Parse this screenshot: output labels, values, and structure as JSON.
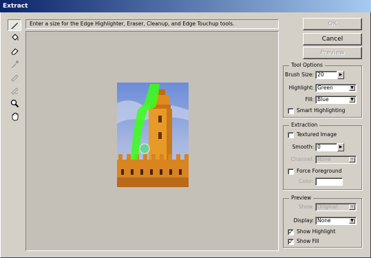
{
  "window": {
    "title": "Extract"
  },
  "hint": "Enter a size for the Edge Highlighter, Eraser, Cleanup, and Edge Touchup tools.",
  "tools": [
    {
      "name": "edge-highlighter-icon",
      "active": true
    },
    {
      "name": "fill-bucket-icon",
      "active": false
    },
    {
      "name": "eraser-icon",
      "active": false
    },
    {
      "name": "eyedropper-icon",
      "active": false
    },
    {
      "name": "cleanup-icon",
      "active": false
    },
    {
      "name": "edge-touchup-icon",
      "active": false
    },
    {
      "name": "zoom-icon",
      "active": false
    },
    {
      "name": "hand-icon",
      "active": false
    }
  ],
  "buttons": {
    "ok": "OK",
    "cancel": "Cancel",
    "preview": "Preview"
  },
  "tool_options": {
    "title": "Tool Options",
    "brush_size_label": "Brush Size:",
    "brush_size_value": "20",
    "highlight_label": "Highlight:",
    "highlight_value": "Green",
    "fill_label": "Fill:",
    "fill_value": "Blue",
    "smart_highlighting_label": "Smart Highlighting",
    "smart_highlighting_checked": false
  },
  "extraction": {
    "title": "Extraction",
    "textured_image_label": "Textured Image",
    "textured_image_checked": false,
    "smooth_label": "Smooth:",
    "smooth_value": "0",
    "channel_label": "Channel:",
    "channel_value": "None",
    "force_foreground_label": "Force Foreground",
    "force_foreground_checked": false,
    "color_label": "Color:"
  },
  "preview": {
    "title": "Preview",
    "show_label": "Show:",
    "show_value": "Original",
    "display_label": "Display:",
    "display_value": "None",
    "show_highlight_label": "Show Highlight",
    "show_highlight_checked": true,
    "show_fill_label": "Show Fill",
    "show_fill_checked": true
  },
  "colors": {
    "titlebar_start": "#0a246a",
    "titlebar_end": "#a6caf0",
    "dialog_bg": "#d4d0c8",
    "highlight": "#00ff00"
  }
}
